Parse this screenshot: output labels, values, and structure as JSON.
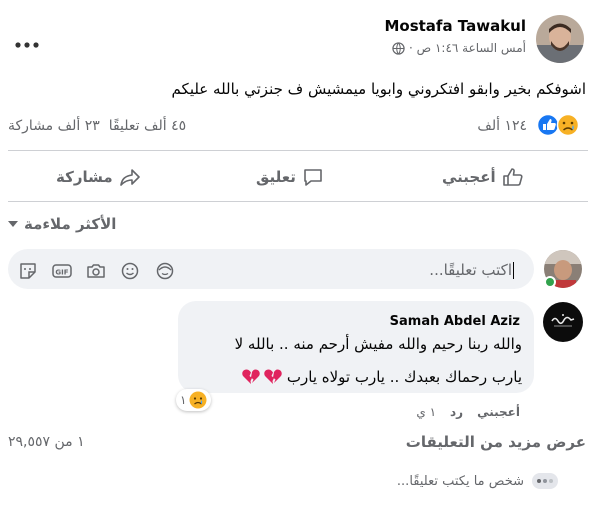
{
  "post": {
    "author": "Mostafa Tawakul",
    "time": "أمس الساعة ١:٤٦ ص ·",
    "text": "اشوفكم بخير وابقو افتكروني وابويا ميمشيش ف جنزتي بالله عليكم",
    "reactions_count": "١٢٤ ألف",
    "comments_count": "٤٥ ألف تعليقًا",
    "shares_count": "٢٣ ألف مشاركة"
  },
  "actions": {
    "like": "أعجبني",
    "comment": "تعليق",
    "share": "مشاركة"
  },
  "sort_label": "الأكثر ملاءمة",
  "composer": {
    "placeholder": "اكتب تعليقًا..."
  },
  "comment": {
    "author": "Samah Abdel Aziz",
    "line1": "والله ربنا رحيم والله مفيش أرحم منه .. بالله لا",
    "line2": "يارب رحماك بعبدك .. يارب تولاه يارب",
    "like": "أعجبني",
    "reply": "رد",
    "time": "١ ي",
    "reaction_count": "١"
  },
  "more_comments": {
    "label": "عرض مزيد من التعليقات",
    "count": "١ من ٢٩,٥٥٧"
  },
  "typing": "شخص ما يكتب تعليقًا...",
  "colors": {
    "accent": "#1877f2",
    "secondary_text": "#65676b",
    "bubble": "#f0f2f5",
    "online": "#31a24c"
  }
}
